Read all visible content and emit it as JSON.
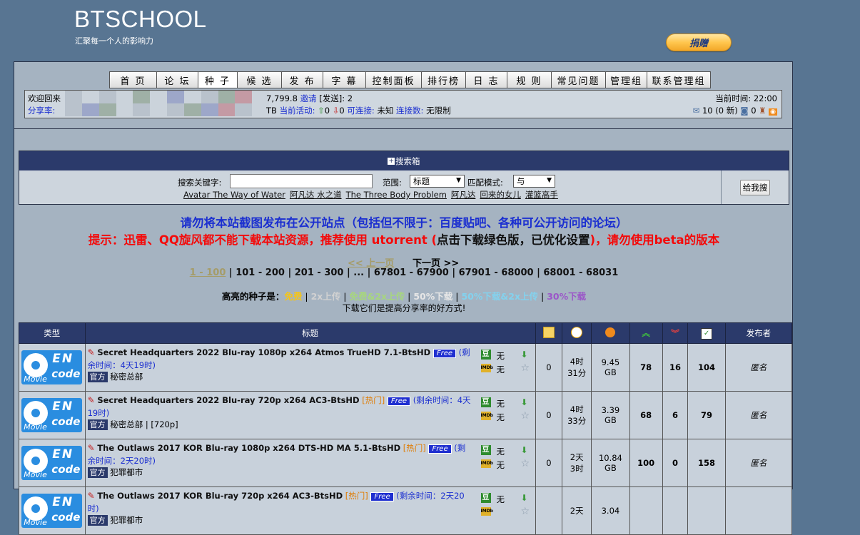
{
  "site": {
    "logo": "BTSCHOOL",
    "slogan": "汇聚每一个人的影响力",
    "donate": "捐赠"
  },
  "nav": [
    "首 页",
    "论 坛",
    "种 子",
    "候 选",
    "发 布",
    "字 幕",
    "控制面板",
    "排行榜",
    "日 志",
    "规 则",
    "常见问题",
    "管理组",
    "联系管理组"
  ],
  "nav_active_index": 2,
  "userbar": {
    "welcome": "欢迎回来",
    "ratio_label": "分享率:",
    "stats_tail": "7,799.8",
    "invite": "邀请",
    "sent_label": "[发送]: 2",
    "upload_tail": "TB",
    "activity_label": "当前活动:",
    "seeding": "0",
    "leeching": "0",
    "connectable_label": "可连接:",
    "connectable_value": "未知",
    "conns_label": "连接数:",
    "conns_value": "无限制",
    "time_label": "当前时间:",
    "time_value": "22:00",
    "msg_text": "10 (0 新)",
    "friends_count": "0"
  },
  "search": {
    "header": "搜索箱",
    "keyword_label": "搜索关键字:",
    "range_label": "范围:",
    "range_value": "标题",
    "match_label": "匹配模式:",
    "match_value": "与",
    "button": "给我搜",
    "hot": [
      "Avatar The Way of Water",
      "阿凡达 水之道",
      "The Three Body Problem",
      "阿凡达",
      "回来的女儿",
      "灌篮高手"
    ]
  },
  "notices": {
    "line1": "请勿将本站截图发布在公开站点（包括但不限于：百度贴吧、各种可公开访问的论坛）",
    "line2a": "提示：迅雷、QQ旋风都不能下载本站资源，推荐使用 utorrent (",
    "line2b": "点击下载绿色版，已优化设置",
    "line2c": ")，请勿使用beta的版本"
  },
  "pager": {
    "prev": "<< 上一页",
    "next": "下一页 >>",
    "current": "1 - 100",
    "pages": [
      "101 - 200",
      "201 - 300",
      "...",
      "67801 - 67900",
      "67901 - 68000",
      "68001 - 68031"
    ]
  },
  "legend": {
    "label": "高亮的种子是：",
    "items": [
      {
        "text": "免费",
        "color": "#f5c518"
      },
      {
        "text": "2x上传",
        "color": "#d1d1d1"
      },
      {
        "text": "免费&2x上传",
        "color": "#a7d77d"
      },
      {
        "text": "50%下载",
        "color": "#e6e6e6"
      },
      {
        "text": "50%下载&2x上传",
        "color": "#83d2ee"
      },
      {
        "text": "30%下载",
        "color": "#9b56c8"
      }
    ],
    "note": "下载它们是提高分享率的好方式!"
  },
  "table": {
    "headers": {
      "type": "类型",
      "title": "标题",
      "uploader": "发布者"
    },
    "rows": [
      {
        "name": "Secret Headquarters 2022 Blu-ray 1080p x264 Atmos TrueHD 7.1-BtsHD",
        "hot": "",
        "free": "Free",
        "rem_a": "(剩余时",
        "rem_b": "间：4天19时)",
        "tag": "官方",
        "sub": "秘密总部",
        "wu1": "无",
        "wu2": "无",
        "comments": "0",
        "time": "4时\n31分",
        "size": "9.45\nGB",
        "seeders": "78",
        "leechers": "16",
        "completed": "104",
        "uploader": "匿名"
      },
      {
        "name": "Secret Headquarters 2022 Blu-ray 720p x264 AC3-BtsHD",
        "hot": "[热门]",
        "free": "Free",
        "rem_a": "(剩余时间：4天19",
        "rem_b": "时)",
        "tag": "官方",
        "sub": "秘密总部 | [720p]",
        "wu1": "无",
        "wu2": "无",
        "comments": "0",
        "time": "4时\n33分",
        "size": "3.39\nGB",
        "seeders": "68",
        "leechers": "6",
        "completed": "79",
        "uploader": "匿名"
      },
      {
        "name": "The Outlaws 2017 KOR Blu-ray 1080p x264 DTS-HD MA 5.1-BtsHD",
        "hot": "[热门]",
        "free": "Free",
        "rem_a": "(剩余时",
        "rem_b": "间：2天20时)",
        "tag": "官方",
        "sub": "犯罪都市",
        "wu1": "无",
        "wu2": "无",
        "comments": "0",
        "time": "2天\n3时",
        "size": "10.84\nGB",
        "seeders": "100",
        "leechers": "0",
        "completed": "158",
        "uploader": "匿名"
      },
      {
        "name": "The Outlaws 2017 KOR Blu-ray 720p x264 AC3-BtsHD",
        "hot": "[热门]",
        "free": "Free",
        "rem_a": "(剩余时间：2天20时)",
        "rem_b": "",
        "tag": "官方",
        "sub": "犯罪都市",
        "wu1": "无",
        "wu2": "",
        "comments": "",
        "time": "2天",
        "size": "3.04",
        "seeders": "",
        "leechers": "",
        "completed": "",
        "uploader": ""
      }
    ],
    "cat_en": "EN",
    "cat_code": "code",
    "cat_movie": "Movie",
    "dou": "豆",
    "imdb": "IMDb"
  }
}
